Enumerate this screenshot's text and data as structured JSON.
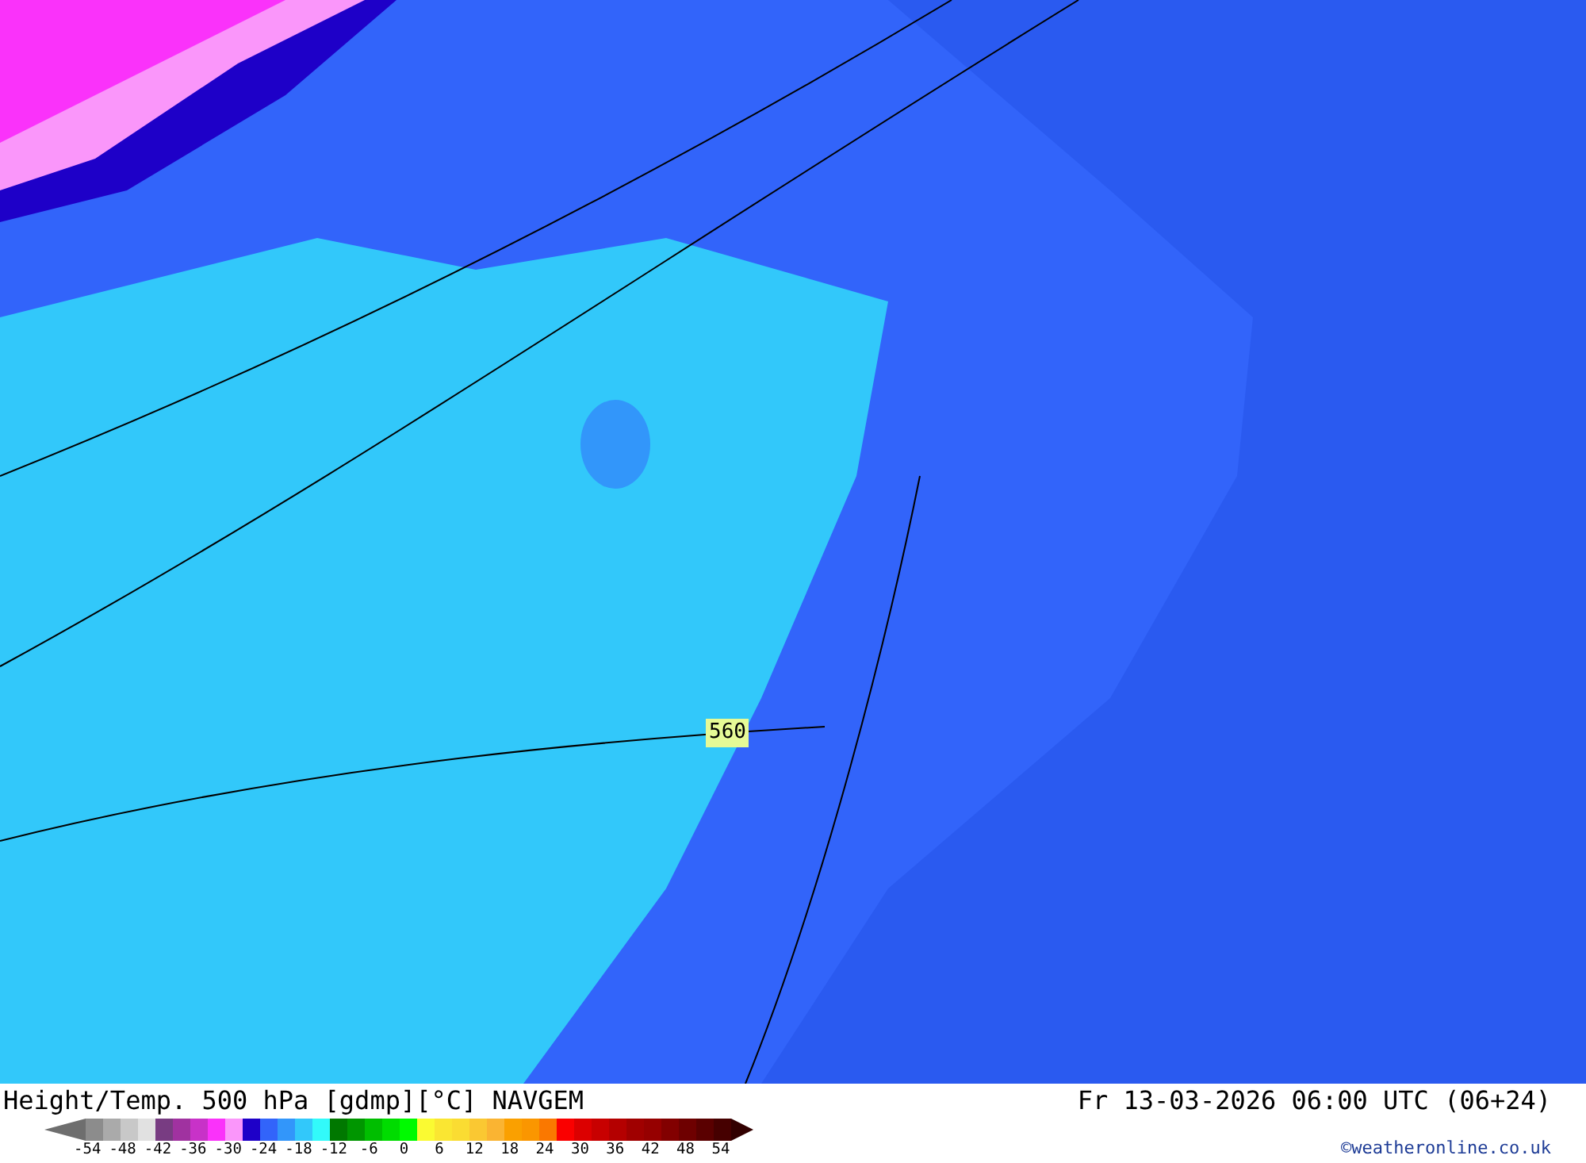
{
  "map": {
    "contour_label": "560"
  },
  "footer": {
    "title": "Height/Temp. 500 hPa [gdmp][°C] NAVGEM",
    "valid_time": "Fr 13-03-2026 06:00 UTC (06+24)",
    "credit": "©weatheronline.co.uk"
  },
  "legend": {
    "low_arrow": {
      "color": "#6e6e6e"
    },
    "high_arrow": {
      "color": "#320000"
    },
    "swatches": [
      {
        "color": "#8c8c8c"
      },
      {
        "color": "#aaaaaa"
      },
      {
        "color": "#c8c8c8"
      },
      {
        "color": "#e1e1e1"
      },
      {
        "color": "#783c82"
      },
      {
        "color": "#a032a0"
      },
      {
        "color": "#c832c8"
      },
      {
        "color": "#fa32fa"
      },
      {
        "color": "#fa96fa"
      },
      {
        "color": "#1e00c8"
      },
      {
        "color": "#3264fa"
      },
      {
        "color": "#3296fa"
      },
      {
        "color": "#32c8fa"
      },
      {
        "color": "#32fafa"
      },
      {
        "color": "#007800"
      },
      {
        "color": "#009600"
      },
      {
        "color": "#00be00"
      },
      {
        "color": "#00dc00"
      },
      {
        "color": "#00fa00"
      },
      {
        "color": "#fafa32"
      },
      {
        "color": "#fae632"
      },
      {
        "color": "#fadc32"
      },
      {
        "color": "#fac832"
      },
      {
        "color": "#fab432"
      },
      {
        "color": "#faa000"
      },
      {
        "color": "#fa9600"
      },
      {
        "color": "#fa7800"
      },
      {
        "color": "#fa0000"
      },
      {
        "color": "#dc0000"
      },
      {
        "color": "#c80000"
      },
      {
        "color": "#b40000"
      },
      {
        "color": "#a00000"
      },
      {
        "color": "#960000"
      },
      {
        "color": "#820000"
      },
      {
        "color": "#6e0000"
      },
      {
        "color": "#5a0000"
      },
      {
        "color": "#460000"
      }
    ],
    "labels": [
      "-54",
      "-48",
      "-42",
      "-36",
      "-30",
      "-24",
      "-18",
      "-12",
      "-6",
      "0",
      "6",
      "12",
      "18",
      "24",
      "30",
      "36",
      "42",
      "48",
      "54"
    ]
  }
}
